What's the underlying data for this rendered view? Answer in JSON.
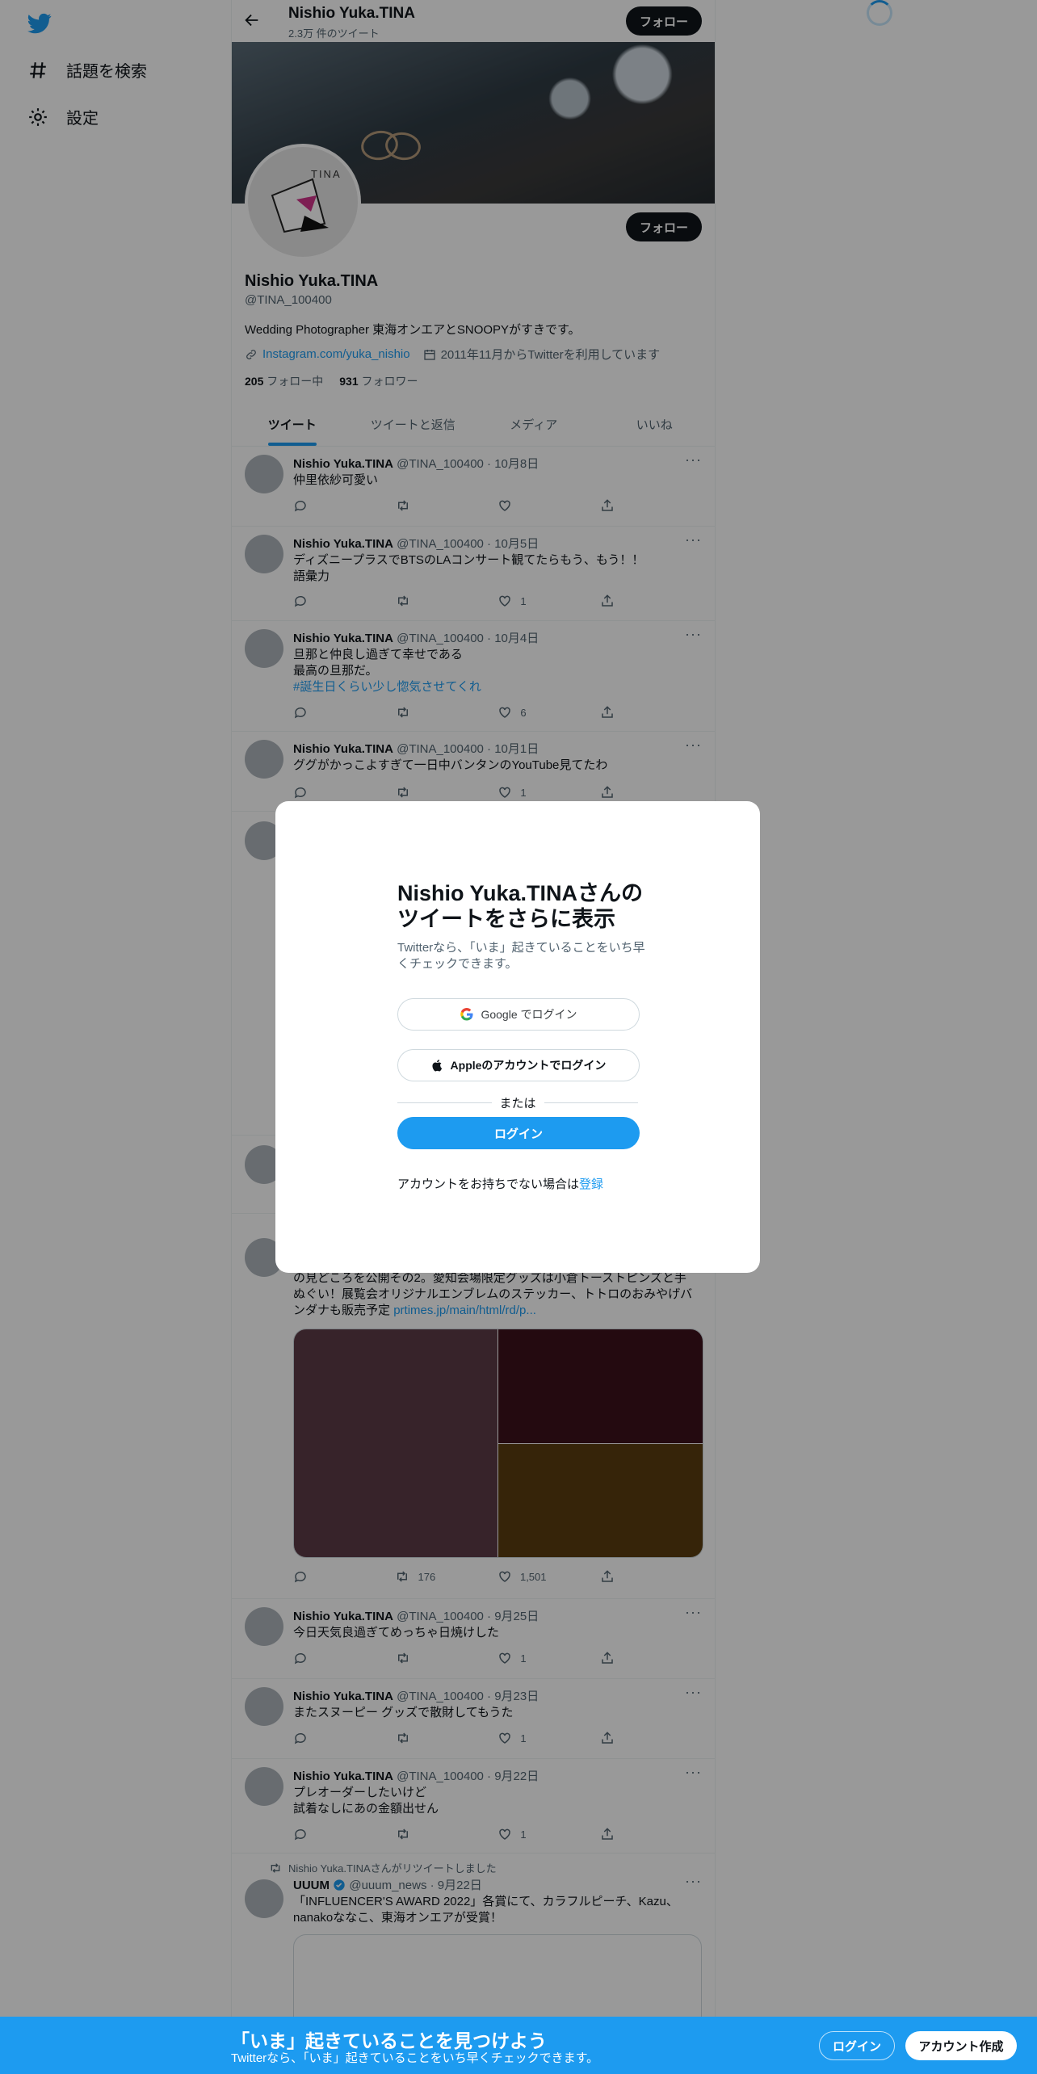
{
  "nav": {
    "explore": "話題を検索",
    "settings": "設定"
  },
  "header": {
    "name": "Nishio Yuka.TINA",
    "tweet_count": "2.3万 件のツイート",
    "follow": "フォロー"
  },
  "profile": {
    "name": "Nishio Yuka.TINA",
    "handle": "@TINA_100400",
    "bio": "Wedding Photographer 東海オンエアとSNOOPYがすきです。",
    "link": "Instagram.com/yuka_nishio",
    "joined": "2011年11月からTwitterを利用しています",
    "following_count": "205",
    "following_label": "フォロー中",
    "followers_count": "931",
    "followers_label": "フォロワー",
    "follow": "フォロー",
    "avatar_text": "TINA"
  },
  "tabs": [
    "ツイート",
    "ツイートと返信",
    "メディア",
    "いいね"
  ],
  "tweets": [
    {
      "name": "Nishio Yuka.TINA",
      "meta": "@TINA_100400 · 10月8日",
      "text": "仲里依紗可愛い",
      "like": ""
    },
    {
      "name": "Nishio Yuka.TINA",
      "meta": "@TINA_100400 · 10月5日",
      "text": "ディズニープラスでBTSのLAコンサート観てたらもう、もう！！語彙力",
      "like": "1"
    },
    {
      "name": "Nishio Yuka.TINA",
      "meta": "@TINA_100400 · 10月4日",
      "line1": "旦那と仲良し過ぎて幸せである",
      "line2": "最高の旦那だ。",
      "hashtag": "#誕生日くらい少し惚気させてくれ",
      "like": "6"
    },
    {
      "name": "Nishio Yuka.TINA",
      "meta": "@TINA_100400 · 10月1日",
      "text": "ググがかっこよすぎて一日中バンタンのYouTube見てたわ",
      "like": "1"
    },
    {
      "text": "の見どころを公開その2。愛知会場限定グッズは小倉トーストピンズと手ぬぐい！展覧会オリジナルエンブレムのステッカー、トトロのおみやげバンダナも販売予定",
      "link": "prtimes.jp/main/html/rd/p...",
      "retweet": "176",
      "like": "1,501"
    },
    {
      "name": "Nishio Yuka.TINA",
      "meta": "@TINA_100400 · 9月25日",
      "text": "今日天気良過ぎてめっちゃ日焼けした",
      "like": "1"
    },
    {
      "name": "Nishio Yuka.TINA",
      "meta": "@TINA_100400 · 9月23日",
      "text": "またスヌーピー グッズで散財してもうた",
      "like": "1"
    },
    {
      "name": "Nishio Yuka.TINA",
      "meta": "@TINA_100400 · 9月22日",
      "line1": "プレオーダーしたいけど",
      "line2": "試着なしにあの金額出せん",
      "like": "1"
    },
    {
      "retweeted_by": "Nishio Yuka.TINAさんがリツイートしました",
      "name": "UUUM",
      "meta": "@uuum_news · 9月22日",
      "text": "「INFLUENCER'S AWARD 2022」各賞にて、カラフルピーチ、Kazu、nanakoななこ、東海オンエアが受賞！"
    }
  ],
  "modal": {
    "title": "Nishio Yuka.TINAさんのツイートをさらに表示",
    "subtitle": "Twitterなら、「いま」起きていることをいち早くチェックできます。",
    "google": "Google でログイン",
    "apple": "Appleのアカウントでログイン",
    "or": "または",
    "login": "ログイン",
    "no_account": "アカウントをお持ちでない場合は",
    "signup": "登録"
  },
  "bottom": {
    "title": "「いま」起きていることを見つけよう",
    "subtitle": "Twitterなら、「いま」起きていることをいち早くチェックできます。",
    "login": "ログイン",
    "signup": "アカウント作成"
  },
  "colors": {
    "accent": "#1d9bf0",
    "dark": "#0f1419",
    "muted": "#536471"
  }
}
